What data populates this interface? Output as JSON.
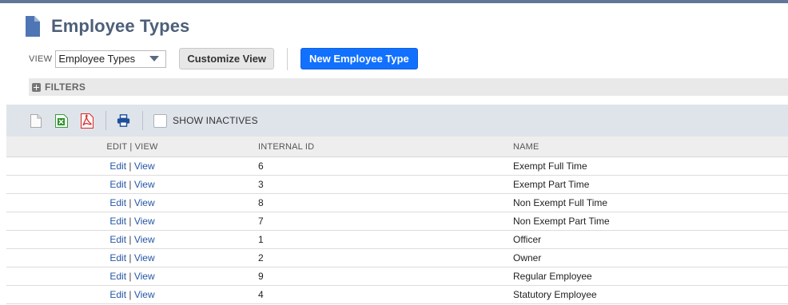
{
  "page": {
    "title": "Employee Types"
  },
  "view": {
    "label": "VIEW",
    "selected": "Employee Types",
    "customize_label": "Customize View",
    "new_label": "New Employee Type"
  },
  "filters": {
    "label": "FILTERS"
  },
  "toolbar": {
    "show_inactives_label": "SHOW INACTIVES"
  },
  "table": {
    "columns": [
      "EDIT | VIEW",
      "INTERNAL ID",
      "NAME"
    ],
    "edit_label": "Edit",
    "separator": " | ",
    "view_label": "View",
    "rows": [
      {
        "id": "6",
        "name": "Exempt Full Time"
      },
      {
        "id": "3",
        "name": "Exempt Part Time"
      },
      {
        "id": "8",
        "name": "Non Exempt Full Time"
      },
      {
        "id": "7",
        "name": "Non Exempt Part Time"
      },
      {
        "id": "1",
        "name": "Officer"
      },
      {
        "id": "2",
        "name": "Owner"
      },
      {
        "id": "9",
        "name": "Regular Employee"
      },
      {
        "id": "4",
        "name": "Statutory Employee"
      }
    ]
  },
  "colors": {
    "title": "#4d5f79",
    "primary_button": "#1270ff",
    "link": "#2456a6",
    "toolbar_bg": "#dfe4eb"
  },
  "icons": [
    "page-icon",
    "chevron-down-icon",
    "plus-icon",
    "csv-export-icon",
    "excel-export-icon",
    "pdf-export-icon",
    "print-icon"
  ]
}
